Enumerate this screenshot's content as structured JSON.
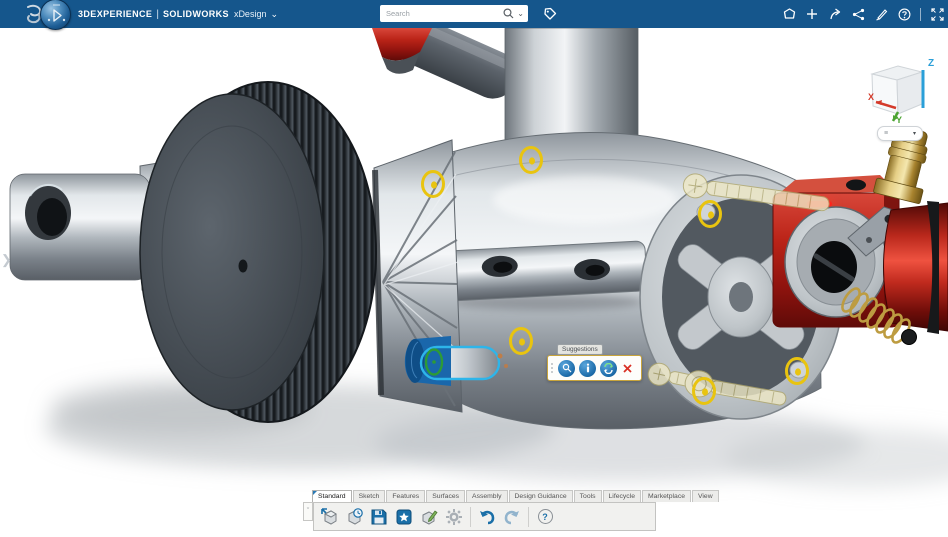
{
  "topbar": {
    "brand": {
      "platform": "3DEXPERIENCE",
      "separator": "|",
      "product": "SOLIDWORKS",
      "app": "xDesign",
      "menu_caret": "⌄"
    },
    "search": {
      "placeholder": "Search",
      "caret": "⌄"
    },
    "right_icons": [
      {
        "name": "assistant"
      },
      {
        "name": "add"
      },
      {
        "name": "share-forward"
      },
      {
        "name": "share-nodes"
      },
      {
        "name": "annotate-pen"
      },
      {
        "name": "help"
      },
      {
        "name": "fullscreen"
      }
    ]
  },
  "viewport": {
    "expand_chevron": "❯",
    "viewcube": {
      "axis_x": "X",
      "axis_y": "Y",
      "axis_z": "Z"
    },
    "view_options": {
      "list_glyph": "≡",
      "caret": "▾"
    },
    "suggestions": {
      "title": "Suggestions",
      "buttons": [
        {
          "name": "preview"
        },
        {
          "name": "info"
        },
        {
          "name": "replace"
        },
        {
          "name": "close"
        }
      ]
    },
    "model": {
      "name": "engine-assembly",
      "selection_outline_color": "#2db5ea",
      "selected_face_color": "#1a67ab",
      "mate_marker_color": "#e9c40f",
      "sketch_marker_color": "#2d9b36"
    }
  },
  "bottom_toolbar": {
    "collapse_glyph": "ˇ",
    "help_glyph": "?",
    "tabs": [
      {
        "label": "Standard",
        "active": true
      },
      {
        "label": "Sketch",
        "active": false
      },
      {
        "label": "Features",
        "active": false
      },
      {
        "label": "Surfaces",
        "active": false
      },
      {
        "label": "Assembly",
        "active": false
      },
      {
        "label": "Design Guidance",
        "active": false
      },
      {
        "label": "Tools",
        "active": false
      },
      {
        "label": "Lifecycle",
        "active": false
      },
      {
        "label": "Marketplace",
        "active": false
      },
      {
        "label": "View",
        "active": false
      }
    ],
    "buttons": [
      {
        "name": "insert-part"
      },
      {
        "name": "part-history"
      },
      {
        "name": "save"
      },
      {
        "name": "new-part"
      },
      {
        "name": "edit-part"
      },
      {
        "name": "settings"
      },
      {
        "name": "undo"
      },
      {
        "name": "redo"
      },
      {
        "name": "help"
      }
    ]
  },
  "colors": {
    "topbar_bg": "#15568c",
    "accent_blue": "#1a6fa8",
    "red_part": "#b01c15",
    "brass": "#caa84e"
  }
}
